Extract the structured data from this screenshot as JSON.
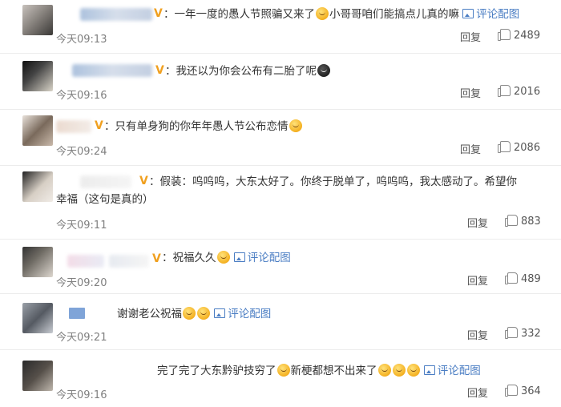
{
  "comments": [
    {
      "text": "：一年一度的愚人节照骗又来了",
      "text2": "小哥哥咱们能搞点儿真的嘛",
      "pic_label": "评论配图",
      "time": "今天09:13",
      "reply": "回复",
      "likes": "2489"
    },
    {
      "text": "：我还以为你会公布有二胎了呢",
      "time": "今天09:16",
      "reply": "回复",
      "likes": "2016"
    },
    {
      "text": "：只有单身狗的你年年愚人节公布恋情",
      "time": "今天09:24",
      "reply": "回复",
      "likes": "2086"
    },
    {
      "text": "：假装：呜呜呜，大东太好了。你终于脱单了，呜呜呜，我太感动了。希望你",
      "text2": "幸福（这句是真的）",
      "time": "今天09:11",
      "reply": "回复",
      "likes": "883"
    },
    {
      "text": "：祝福久久",
      "pic_label": "评论配图",
      "time": "今天09:20",
      "reply": "回复",
      "likes": "489"
    },
    {
      "text": "谢谢老公祝福",
      "pic_label": "评论配图",
      "time": "今天09:21",
      "reply": "回复",
      "likes": "332"
    },
    {
      "text": "完了完了大东黔驴技穷了",
      "text2": "新梗都想不出来了",
      "pic_label": "评论配图",
      "time": "今天09:16",
      "reply": "回复",
      "likes": "364"
    }
  ],
  "icons": {
    "verified": "verified-v-icon",
    "emoji": "emoji-face-icon",
    "picture": "picture-icon",
    "like": "thumbs-up-icon"
  },
  "colors": {
    "link": "#4a7dc3",
    "verified": "#f0a020",
    "muted": "#808080"
  }
}
